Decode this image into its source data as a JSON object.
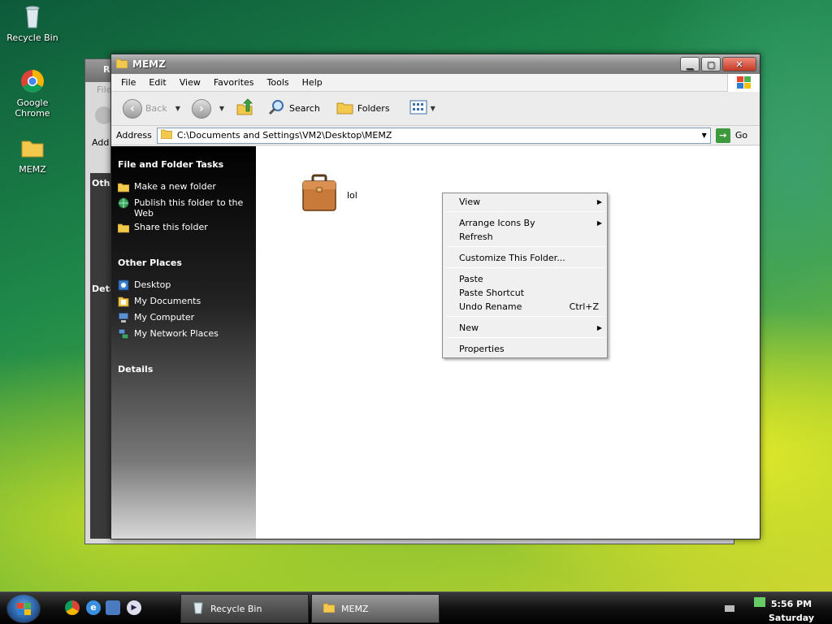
{
  "desktop": {
    "icons": [
      {
        "label": "Recycle Bin"
      },
      {
        "label": "Google Chrome"
      },
      {
        "label": "MEMZ"
      }
    ]
  },
  "back_window": {
    "title_fragment": "R",
    "menu_fragment": "File",
    "address_fragment": "Add",
    "other_fragment": "Othe",
    "details_fragment": "Deta"
  },
  "window": {
    "title": "MEMZ",
    "menu": [
      "File",
      "Edit",
      "View",
      "Favorites",
      "Tools",
      "Help"
    ],
    "toolbar": {
      "back": "Back",
      "search": "Search",
      "folders": "Folders"
    },
    "address": {
      "label": "Address",
      "value": "C:\\Documents and Settings\\VM2\\Desktop\\MEMZ",
      "go": "Go"
    },
    "tasks": {
      "heading": "File and Folder Tasks",
      "items": [
        "Make a new folder",
        "Publish this folder to the Web",
        "Share this folder"
      ]
    },
    "places": {
      "heading": "Other Places",
      "items": [
        "Desktop",
        "My Documents",
        "My Computer",
        "My Network Places"
      ]
    },
    "details": {
      "heading": "Details"
    },
    "files": [
      {
        "name": "lol"
      }
    ]
  },
  "context_menu": {
    "items": [
      {
        "label": "View",
        "submenu": true
      },
      {
        "label": "Arrange Icons By",
        "submenu": true
      },
      {
        "label": "Refresh"
      },
      {
        "label": "Customize This Folder..."
      },
      {
        "label": "Paste"
      },
      {
        "label": "Paste Shortcut"
      },
      {
        "label": "Undo Rename",
        "shortcut": "Ctrl+Z"
      },
      {
        "label": "New",
        "submenu": true
      },
      {
        "label": "Properties"
      }
    ]
  },
  "taskbar": {
    "tasks": [
      {
        "label": "Recycle Bin"
      },
      {
        "label": "MEMZ"
      }
    ],
    "clock": {
      "time": "5:56 PM",
      "day": "Saturday"
    }
  },
  "colors": {
    "accent_green": "#3c9a3c",
    "window_frame": "#8d8d8d"
  }
}
